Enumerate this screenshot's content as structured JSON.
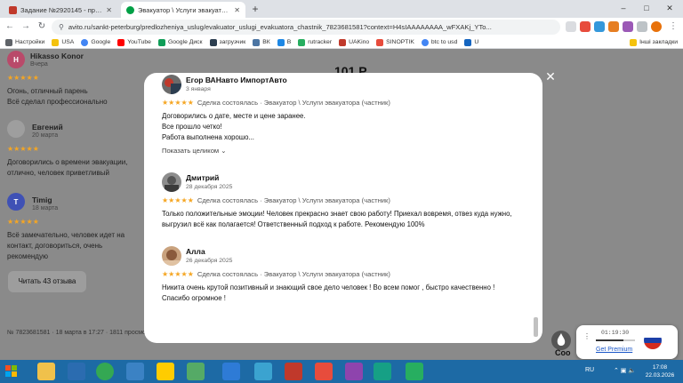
{
  "browser": {
    "tabs": [
      {
        "label": "Задание №2920145 - просмотр",
        "favicon": "sp-favicon",
        "active": false
      },
      {
        "label": "Эвакуатор \\ Услуги эвакуатора",
        "favicon": "avito-favicon",
        "active": true
      }
    ],
    "new_tab": "+",
    "window_controls": {
      "minimize": "–",
      "maximize": "□",
      "close": "✕"
    },
    "url": "avito.ru/sankt-peterburg/predlozheniya_uslug/evakuator_uslugi_evakuatora_chastnik_7823681581?context=H4sIAAAAAAAA_wFXAKj_YTo...",
    "bookmarks": [
      "Настройки",
      "USA",
      "Google",
      "YouTube",
      "Google Диск",
      "загрузчик",
      "ВК",
      "В",
      "rutracker",
      "UAKino",
      "SINOPTIK",
      "btc to usd",
      "U",
      "Інші закладки"
    ]
  },
  "background": {
    "reviews": [
      {
        "initial": "H",
        "name": "Hikasso Konor",
        "date": "Вчера",
        "stars": "★★★★★",
        "text": "Огонь, отличный парень\nВсё сделал профессионально"
      },
      {
        "initial": "",
        "name": "Евгений",
        "date": "20 марта",
        "stars": "★★★★★",
        "text": "Договорились о времени эвакуации, отлично, человек приветливый"
      },
      {
        "initial": "T",
        "name": "Timig",
        "date": "18 марта",
        "stars": "★★★★★",
        "text": "Всё замечательно, человек идет на контакт, договориться, очень рекомендую"
      }
    ],
    "read_reviews_button": "Читать 43 отзыва",
    "footer": "№ 7823681581 · 18 марта в 17:27 · 1811 просмотров",
    "price_partial": "101 Р"
  },
  "modal": {
    "close": "✕",
    "reviews": [
      {
        "name": "Егор ВАНавто ИмпортАвто",
        "date": "3 января",
        "stars": "★★★★★",
        "deal": "Сделка состоялась · Эвакуатор \\ Услуги эвакуатора (частник)",
        "text": "Договорились о дате, месте и цене заранее.\nВсе прошло четко!\nРабота выполнена хорошо...",
        "more": "Показать целиком ⌄"
      },
      {
        "name": "Дмитрий",
        "date": "28 декабря 2025",
        "stars": "★★★★★",
        "deal": "Сделка состоялась · Эвакуатор \\ Услуги эвакуатора (частник)",
        "text": "Только положительные эмоции! Человек прекрасно знает свою работу! Приехал вовремя, отвез куда нужно, выгрузил всё как полагается! Ответственный подход к работе. Рекомендую 100%"
      },
      {
        "name": "Алла",
        "date": "26 декабря 2025",
        "stars": "★★★★★",
        "deal": "Сделка состоялась · Эвакуатор \\ Услуги эвакуатора (частник)",
        "text": "Никита очень крутой позитивный и знающий свое дело человек ! Во всем помог , быстро качественно ! Спасибо огромное !"
      }
    ]
  },
  "popup": {
    "time": "01:19:30",
    "link": "Get Premium",
    "partial_text": "Coo"
  },
  "taskbar": {
    "lang": "RU",
    "time": "17:08",
    "date": "22.03.2026"
  },
  "colors": {
    "accent_star": "#f5a623",
    "taskbar": "#1d6aa5",
    "avito_green": "#00a046"
  }
}
